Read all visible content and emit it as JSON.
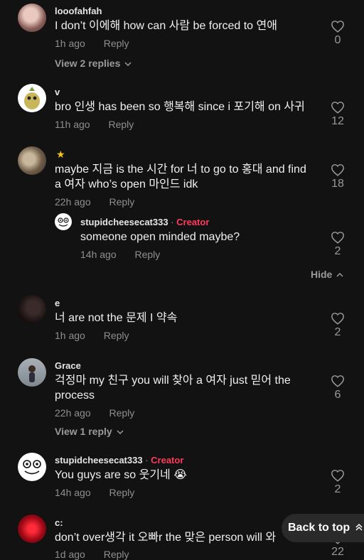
{
  "comments": [
    {
      "user": "looofahfah",
      "text": "I don’t 이에해 how can 사람 be forced to 연애",
      "time": "1h ago",
      "reply": "Reply",
      "likes": "0",
      "view_replies": "View 2 replies",
      "avatar_color": "#b98e86"
    },
    {
      "user": "v",
      "text": "bro 인생 has been so 행복해 since i 포기해 on 사귀",
      "time": "11h ago",
      "reply": "Reply",
      "likes": "12",
      "avatar_color": "#ffffff"
    },
    {
      "user": "★",
      "text_lines": [
        "maybe 지금 is the 시간 for 너 to go to 홍대 and find",
        "a 여자 who’s open 마인드 idk"
      ],
      "time": "22h ago",
      "reply": "Reply",
      "likes": "18",
      "avatar_color": "#8a7c6a"
    },
    {
      "user": "e",
      "text": "너 are not the 문제 I 약속",
      "time": "1h ago",
      "reply": "Reply",
      "likes": "2",
      "avatar_color": "#1c1414"
    },
    {
      "user": "Grace",
      "text_lines": [
        "걱정마 my 친구 you will 찾아 a 여자 just 믿어 the",
        "process"
      ],
      "time": "22h ago",
      "reply": "Reply",
      "likes": "6",
      "view_replies": "View 1 reply",
      "avatar_color": "#9aa0a6"
    },
    {
      "user": "stupidcheesecat333",
      "badge": "Creator",
      "sep": " · ",
      "text": "You guys are so 웃기네 😭",
      "time": "14h ago",
      "reply": "Reply",
      "likes": "2",
      "avatar_color": "#ffffff"
    },
    {
      "user": "c:",
      "text": "don’t over생각 it 오빠r the 맞은 person will 와",
      "time": "1d ago",
      "reply": "Reply",
      "likes": "22",
      "avatar_color": "#c0121e"
    }
  ],
  "nested_reply": {
    "user": "stupidcheesecat333",
    "badge": "Creator",
    "sep": " · ",
    "text": "someone open minded maybe?",
    "time": "14h ago",
    "reply": "Reply",
    "likes": "2"
  },
  "hide_label": "Hide",
  "back_to_top": "Back to top",
  "colors": {
    "background": "#121212",
    "creator": "#ff3b5c",
    "muted": "#8f8f8f"
  }
}
